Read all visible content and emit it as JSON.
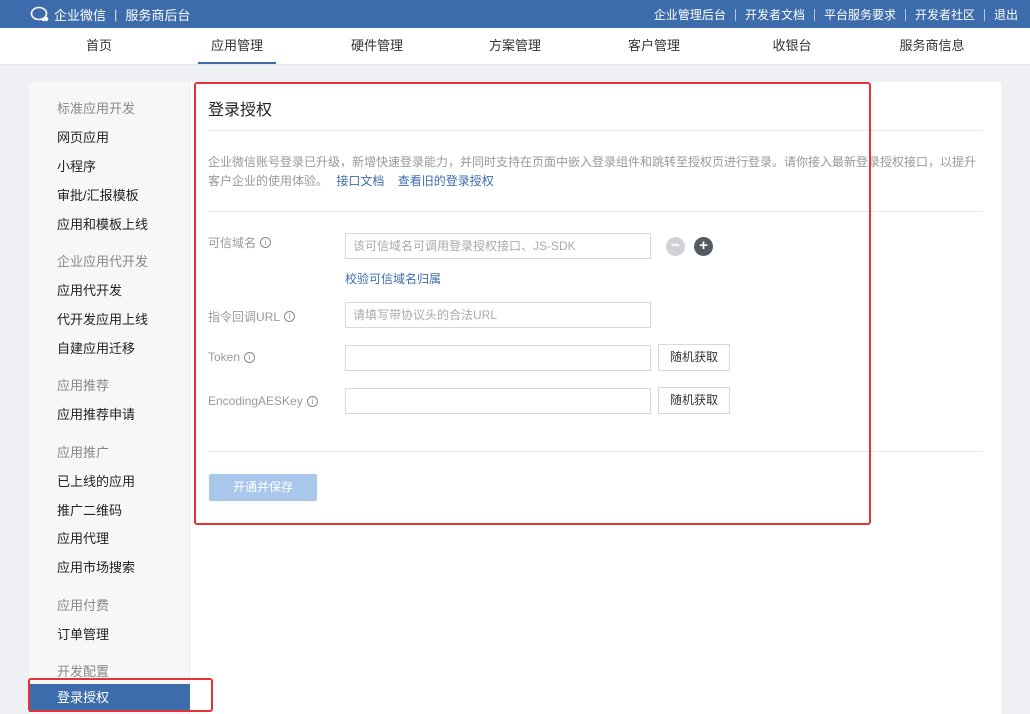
{
  "topbar": {
    "brand": "企业微信",
    "subtitle": "服务商后台",
    "links": [
      "企业管理后台",
      "开发者文档",
      "平台服务要求",
      "开发者社区",
      "退出"
    ]
  },
  "nav": {
    "tabs": [
      "首页",
      "应用管理",
      "硬件管理",
      "方案管理",
      "客户管理",
      "收银台",
      "服务商信息"
    ],
    "active": "应用管理"
  },
  "sidebar": {
    "groups": [
      {
        "title": "标准应用开发",
        "items": [
          "网页应用",
          "小程序",
          "审批/汇报模板",
          "应用和模板上线"
        ]
      },
      {
        "title": "企业应用代开发",
        "items": [
          "应用代开发",
          "代开发应用上线",
          "自建应用迁移"
        ]
      },
      {
        "title": "应用推荐",
        "items": [
          "应用推荐申请"
        ]
      },
      {
        "title": "应用推广",
        "items": [
          "已上线的应用",
          "推广二维码",
          "应用代理",
          "应用市场搜索"
        ]
      },
      {
        "title": "应用付费",
        "items": [
          "订单管理"
        ]
      },
      {
        "title": "开发配置",
        "items": [
          "登录授权"
        ]
      }
    ],
    "active": "登录授权"
  },
  "panel": {
    "title": "登录授权",
    "description": "企业微信账号登录已升级，新增快速登录能力，并同时支持在页面中嵌入登录组件和跳转至授权页进行登录。请你接入最新登录授权接口，以提升客户企业的使用体验。",
    "doc_link": "接口文档",
    "old_link": "查看旧的登录授权",
    "fields": {
      "domain": {
        "label": "可信域名",
        "placeholder": "该可信域名可调用登录授权接口、JS-SDK",
        "value": ""
      },
      "verify_link": "校验可信域名归属",
      "callback": {
        "label": "指令回调URL",
        "placeholder": "请填写带协议头的合法URL",
        "value": ""
      },
      "token": {
        "label": "Token",
        "value": ""
      },
      "aeskey": {
        "label": "EncodingAESKey",
        "value": ""
      }
    },
    "random_button": "随机获取",
    "save_button": "开通并保存"
  },
  "colors": {
    "brand_blue": "#3c6cab",
    "highlight_red": "#e53333",
    "save_disabled": "#a9c7ea"
  }
}
